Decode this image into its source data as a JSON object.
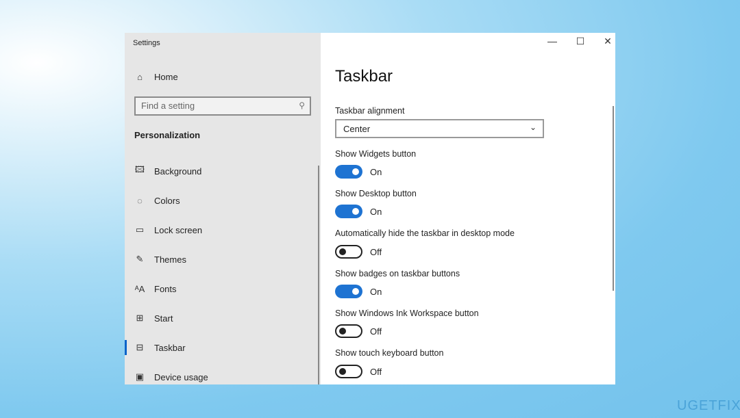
{
  "window": {
    "title": "Settings",
    "controls": {
      "minimize": "—",
      "maximize": "☐",
      "close": "✕"
    }
  },
  "sidebar": {
    "home": "Home",
    "search": {
      "placeholder": "Find a setting"
    },
    "section": "Personalization",
    "items": [
      {
        "label": "Background",
        "icon": "image-icon"
      },
      {
        "label": "Colors",
        "icon": "palette-icon"
      },
      {
        "label": "Lock screen",
        "icon": "lock-screen-icon"
      },
      {
        "label": "Themes",
        "icon": "brush-icon"
      },
      {
        "label": "Fonts",
        "icon": "fonts-icon"
      },
      {
        "label": "Start",
        "icon": "start-grid-icon"
      },
      {
        "label": "Taskbar",
        "icon": "taskbar-icon",
        "selected": true
      },
      {
        "label": "Device usage",
        "icon": "device-usage-icon"
      }
    ]
  },
  "main": {
    "title": "Taskbar",
    "alignment": {
      "label": "Taskbar alignment",
      "value": "Center"
    },
    "toggles": [
      {
        "label": "Show Widgets button",
        "state": "On",
        "on": true
      },
      {
        "label": "Show Desktop button",
        "state": "On",
        "on": true
      },
      {
        "label": "Automatically hide the taskbar in desktop mode",
        "state": "Off",
        "on": false
      },
      {
        "label": "Show badges on taskbar buttons",
        "state": "On",
        "on": true
      },
      {
        "label": "Show Windows Ink Workspace button",
        "state": "Off",
        "on": false
      },
      {
        "label": "Show touch keyboard button",
        "state": "Off",
        "on": false
      }
    ]
  },
  "accent": "#1e73d2",
  "watermark": "UGETFIX"
}
